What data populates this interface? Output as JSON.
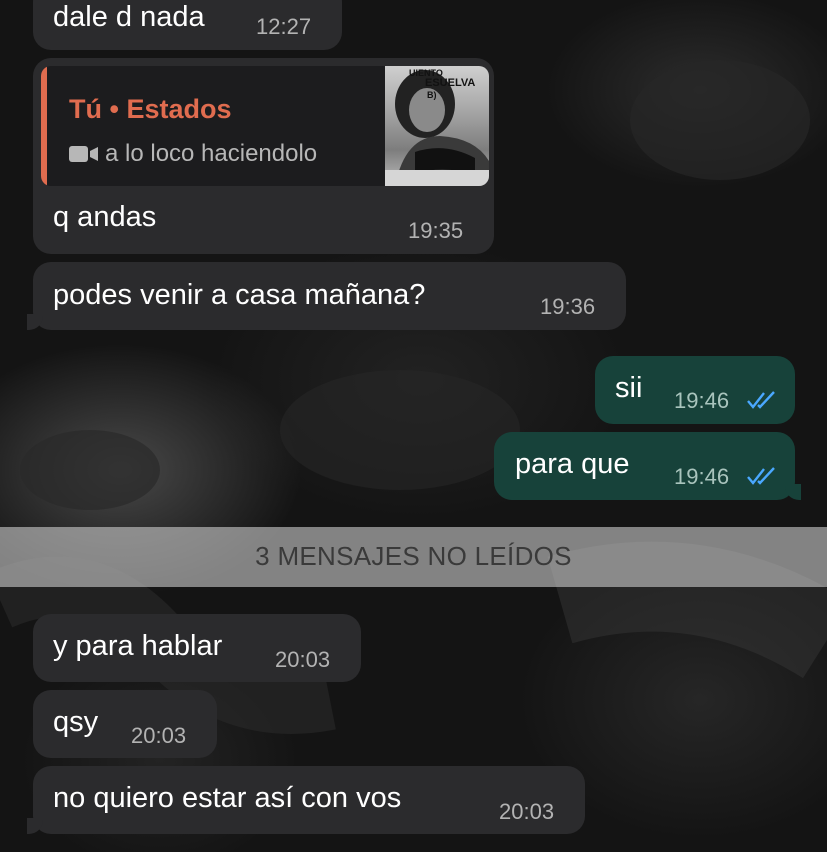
{
  "messages": [
    {
      "text": "dale d nada",
      "time": "12:27"
    },
    {
      "text": "q andas",
      "time": "19:35",
      "reply": {
        "author": "Tú • Estados",
        "caption": "a lo loco haciendolo",
        "media_icon": "video-icon",
        "thumbnail_text": [
          "UIENTO",
          "ESUELVA",
          "B)"
        ]
      }
    },
    {
      "text": "podes venir a casa mañana?",
      "time": "19:36"
    },
    {
      "text": "sii",
      "time": "19:46",
      "status": "read-double-check"
    },
    {
      "text": "para que",
      "time": "19:46",
      "status": "read-double-check"
    },
    {
      "text": "y para hablar",
      "time": "20:03"
    },
    {
      "text": "qsy",
      "time": "20:03"
    },
    {
      "text": "no quiero estar así con vos",
      "time": "20:03"
    }
  ],
  "unread_divider": "3 MENSAJES NO LEÍDOS",
  "colors": {
    "incoming_bubble": "#2b2b2d",
    "outgoing_bubble": "#17423a",
    "reply_accent": "#e06c4f",
    "read_ticks": "#4aa8ff"
  }
}
